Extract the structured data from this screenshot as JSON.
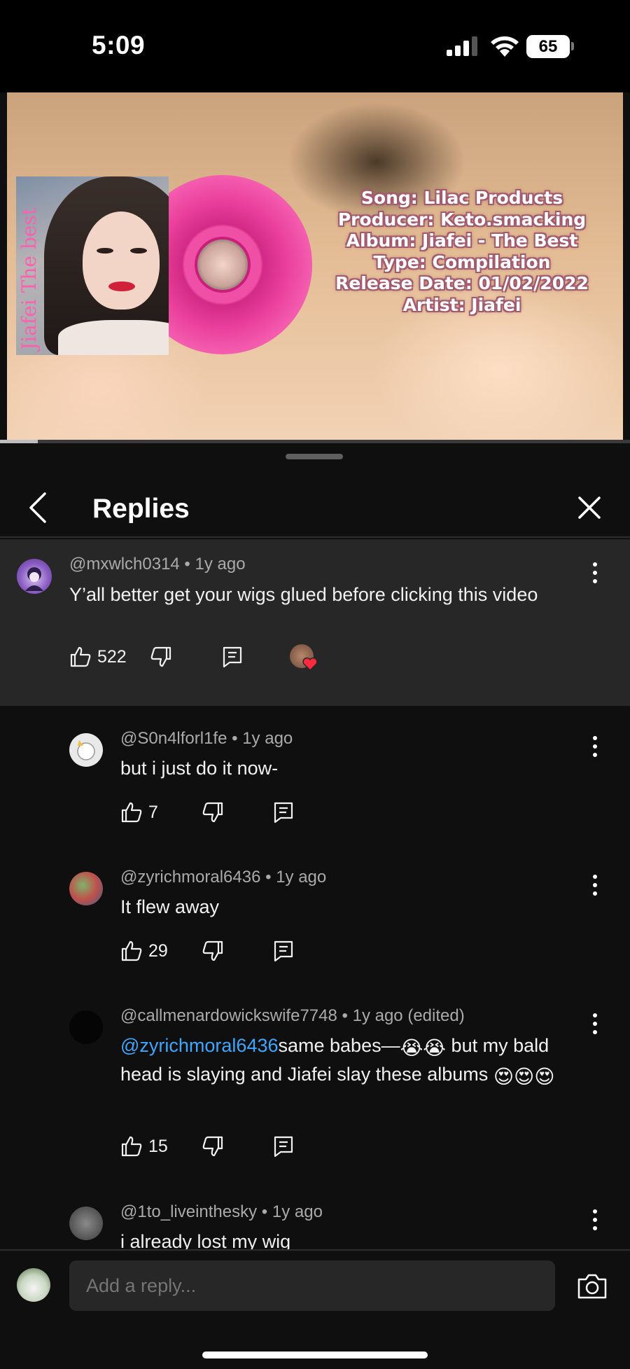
{
  "status_bar": {
    "time": "5:09",
    "battery": "65"
  },
  "video": {
    "cover_text": "Jiafei The best",
    "info_lines": [
      "Song: Lilac Products",
      "Producer: Keto.smacking",
      "Album: Jiafei - The Best",
      "Type: Compilation",
      "Release Date: 01/02/2022",
      "Artist: Jiafei"
    ],
    "progress_fraction": 0.06
  },
  "sheet": {
    "title": "Replies"
  },
  "parent_comment": {
    "handle": "@mxwlch0314",
    "time": "1y ago",
    "text": "Y’all better get your wigs glued before clicking this video",
    "likes": "522"
  },
  "replies": [
    {
      "handle": "@S0n4lforl1fe",
      "time": "1y ago",
      "text": "but i just do it now-",
      "likes": "7"
    },
    {
      "handle": "@zyrichmoral6436",
      "time": "1y ago",
      "text": "It flew away",
      "likes": "29"
    },
    {
      "handle": "@callmenardowickswife7748",
      "time": "1y ago (edited)",
      "mention": "@zyrichmoral6436",
      "text_a": "same babes—",
      "emoji_a": "😭😭",
      "text_b": "but my bald head is slaying and Jiafei slay these albums",
      "emoji_b": "😍😍😍",
      "likes": "15"
    },
    {
      "handle": "@1to_liveinthesky",
      "time": "1y ago",
      "text": "i already lost my wig"
    }
  ],
  "reply_bar": {
    "placeholder": "Add a reply..."
  },
  "icons": {
    "back": "chevron-left-icon",
    "close": "close-icon",
    "like": "thumbs-up-icon",
    "dislike": "thumbs-down-icon",
    "reply": "reply-icon",
    "more": "more-vert-icon",
    "camera": "camera-icon",
    "creator_heart": "heart-icon"
  },
  "colors": {
    "background": "#0f0f0f",
    "parent_bg": "#272727",
    "mention": "#3ea6ff",
    "muted": "#aaaaaa"
  }
}
